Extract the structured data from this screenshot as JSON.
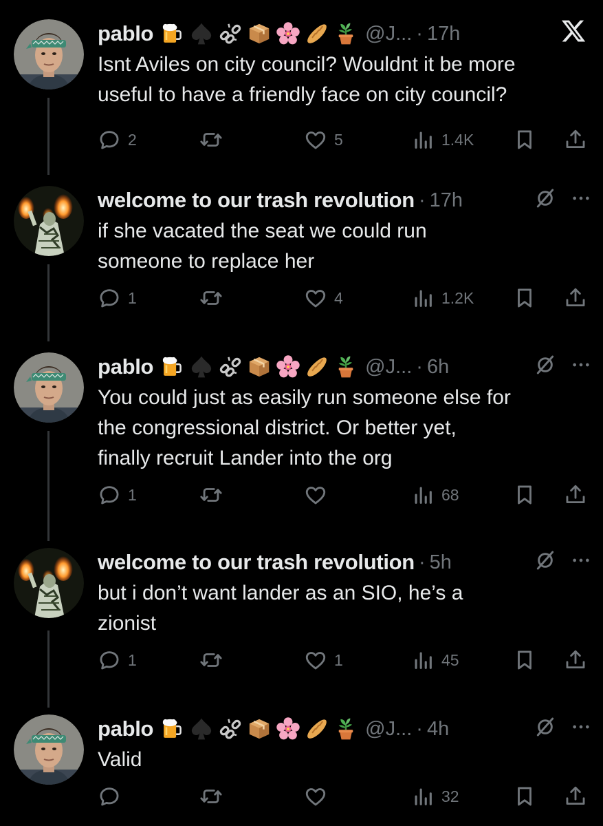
{
  "tweets": [
    {
      "name": "pablo",
      "emojis": [
        "beer-mug",
        "spade",
        "broken-chain",
        "package",
        "cherry-blossom",
        "baguette",
        "potted-plant"
      ],
      "handle": "@J...",
      "time": "17h",
      "text": "Isnt Aviles on city council? Wouldnt it be more\nuseful to have a friendly face on city council?",
      "replies": "2",
      "retweets": "",
      "likes": "5",
      "views": "1.4K",
      "avatar": "pablo"
    },
    {
      "name": "welcome to our trash revolution",
      "emojis": [],
      "handle": "",
      "time": "17h",
      "text": "if she vacated the seat we could run\nsomeone to replace her",
      "replies": "1",
      "retweets": "",
      "likes": "4",
      "views": "1.2K",
      "avatar": "trash"
    },
    {
      "name": "pablo",
      "emojis": [
        "beer-mug",
        "spade",
        "broken-chain",
        "package",
        "cherry-blossom",
        "baguette",
        "potted-plant"
      ],
      "handle": "@J...",
      "time": "6h",
      "text": "You could just as easily run someone else for\nthe congressional district. Or better yet,\nfinally recruit Lander into the org",
      "replies": "1",
      "retweets": "",
      "likes": "",
      "views": "68",
      "avatar": "pablo"
    },
    {
      "name": "welcome to our trash revolution",
      "emojis": [],
      "handle": "",
      "time": "5h",
      "text": "but i don’t want lander as an SIO, he’s a\nzionist",
      "replies": "1",
      "retweets": "",
      "likes": "1",
      "views": "45",
      "avatar": "trash"
    },
    {
      "name": "pablo",
      "emojis": [
        "beer-mug",
        "spade",
        "broken-chain",
        "package",
        "cherry-blossom",
        "baguette",
        "potted-plant"
      ],
      "handle": "@J...",
      "time": "4h",
      "text": "Valid",
      "replies": "",
      "retweets": "",
      "likes": "",
      "views": "32",
      "avatar": "pablo"
    }
  ],
  "colors": {
    "background": "#000000",
    "text": "#e7e9ea",
    "muted": "#71767b",
    "thread_line": "#333639"
  },
  "header_icon": "x-logo-icon"
}
